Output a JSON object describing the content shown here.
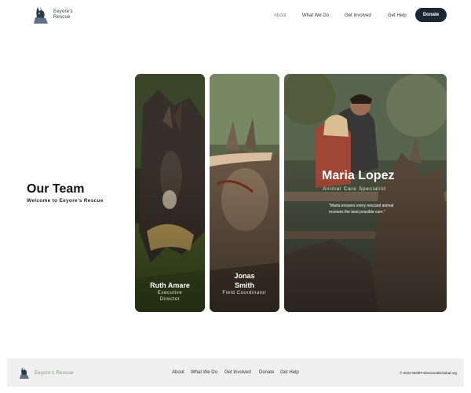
{
  "header": {
    "logo_text": "Eeyore's Rescue",
    "nav": [
      "About",
      "What We Do",
      "Get Involved",
      "Get Help"
    ],
    "active_nav": "About",
    "donate_label": "Donate"
  },
  "intro": {
    "title": "Our Team",
    "subtitle": "Welcome to Eeyore's Rescue"
  },
  "team": [
    {
      "name": "Ruth Amare",
      "role": "Executive Director"
    },
    {
      "name": "Jonas Smith",
      "role": "Field Coordinator"
    },
    {
      "name": "Maria Lopez",
      "role": "Animal Care Specialist",
      "quote": "\"Maria ensures every rescued animal receives the best possible care.\""
    }
  ],
  "footer": {
    "logo_text": "Eeyore's Rescue",
    "nav": [
      "About",
      "What We Do",
      "Get Involved",
      "Donate",
      "Get Help"
    ],
    "copyright": "© 2022 WebProfessionalsGlobal.org"
  },
  "colors": {
    "accent_green": "#6f8f6a",
    "donate_bg": "#1d2733",
    "footer_bg": "#efefef"
  },
  "icons": {
    "logo": "donkey-head-icon"
  }
}
